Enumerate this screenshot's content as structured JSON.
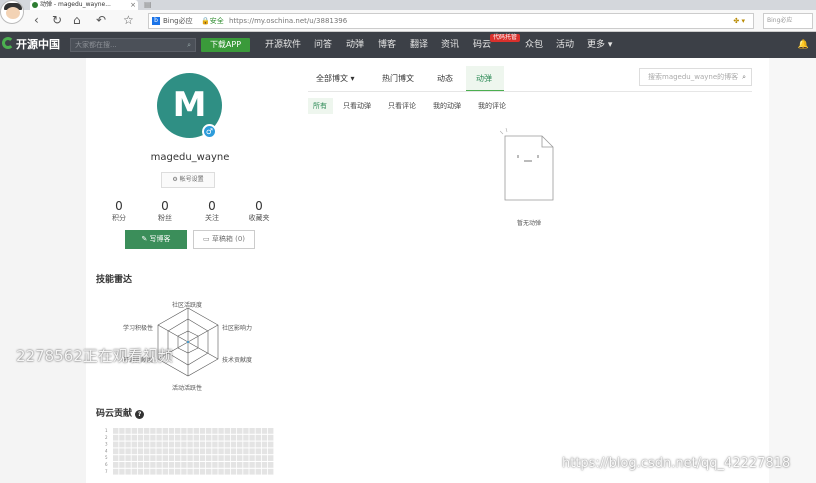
{
  "browser": {
    "tab_title": "动弹 - magedu_wayne...",
    "tab_close": "×",
    "new_tab": "▤",
    "url_badge": "Bing必应",
    "security": "安全",
    "url": "https://my.oschina.net/u/3881396",
    "search_placeholder": "Bing必应",
    "nav_back": "‹",
    "nav_refresh": "↻",
    "nav_home": "⌂",
    "nav_undo": "↶",
    "nav_star": "☆"
  },
  "nav": {
    "logo": "开源中国",
    "search_placeholder": "大家都在搜...",
    "download": "下载APP",
    "items": [
      "开源软件",
      "问答",
      "动弹",
      "博客",
      "翻译",
      "资讯",
      "码云",
      "众包",
      "活动",
      "更多 ▾"
    ],
    "badge": "代码托管"
  },
  "profile": {
    "avatar_letter": "M",
    "username": "magedu_wayne",
    "account_settings": "帐号设置",
    "stats": [
      {
        "value": "0",
        "label": "积分"
      },
      {
        "value": "0",
        "label": "粉丝"
      },
      {
        "value": "0",
        "label": "关注"
      },
      {
        "value": "0",
        "label": "收藏夹"
      }
    ],
    "write_blog": "写博客",
    "draft_box": "草稿箱 (0)"
  },
  "skills": {
    "title": "技能雷达",
    "axes": [
      "社区活跃度",
      "社区影响力",
      "技术贡献度",
      "活动活跃性",
      "开源贡献度",
      "学习积极性"
    ]
  },
  "gitee": {
    "title": "码云贡献",
    "help": "?",
    "day_labels": [
      "1",
      "2",
      "3",
      "4",
      "5",
      "6",
      "7"
    ]
  },
  "content": {
    "tabs": [
      "全部博文 ▾",
      "热门博文",
      "动态",
      "动弹"
    ],
    "active_tab": "动弹",
    "search_placeholder": "搜索magedu_wayne的博客",
    "subtabs": [
      "所有",
      "只看动弹",
      "只看评论",
      "我的动弹",
      "我的评论"
    ],
    "empty_text": "暂无动弹"
  },
  "overlay": {
    "viewer_watermark": "2278562正在观看视频",
    "site_watermark": "https://blog.csdn.net/qq_42227818"
  }
}
